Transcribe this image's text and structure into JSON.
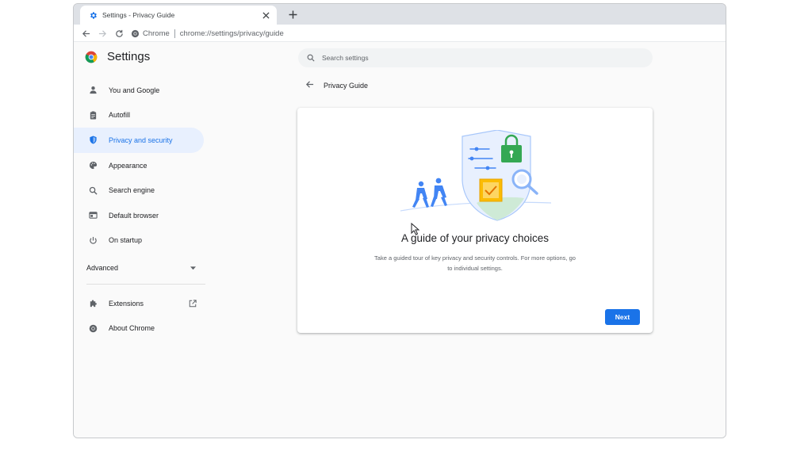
{
  "browser": {
    "tab": {
      "title": "Settings - Privacy Guide",
      "icon": "gear-icon",
      "close_icon": "close-icon"
    },
    "new_tab_icon": "plus-icon",
    "toolbar": {
      "back_icon": "back-arrow-icon",
      "forward_icon": "forward-arrow-icon",
      "reload_icon": "reload-icon",
      "site_chip": "Chrome",
      "url": "chrome://settings/privacy/guide"
    }
  },
  "settings": {
    "title": "Settings",
    "search_placeholder": "Search settings",
    "nav": [
      {
        "label": "You and Google",
        "icon": "person-icon"
      },
      {
        "label": "Autofill",
        "icon": "clipboard-icon"
      },
      {
        "label": "Privacy and security",
        "icon": "shield-icon",
        "active": true
      },
      {
        "label": "Appearance",
        "icon": "palette-icon"
      },
      {
        "label": "Search engine",
        "icon": "search-icon"
      },
      {
        "label": "Default browser",
        "icon": "browser-window-icon"
      },
      {
        "label": "On startup",
        "icon": "power-icon"
      }
    ],
    "advanced_label": "Advanced",
    "nav_secondary": [
      {
        "label": "Extensions",
        "icon": "puzzle-icon"
      },
      {
        "label": "About Chrome",
        "icon": "chrome-icon"
      }
    ]
  },
  "privacy_guide": {
    "header": "Privacy Guide",
    "card_title": "A guide of your privacy choices",
    "card_description": "Take a guided tour of key privacy and security controls. For more options, go to individual settings.",
    "next_label": "Next"
  },
  "colors": {
    "accent": "#1a73e8",
    "active_nav_bg": "#e8f0fe",
    "tabstrip_bg": "#dee1e6",
    "page_bg": "#fafafa"
  }
}
